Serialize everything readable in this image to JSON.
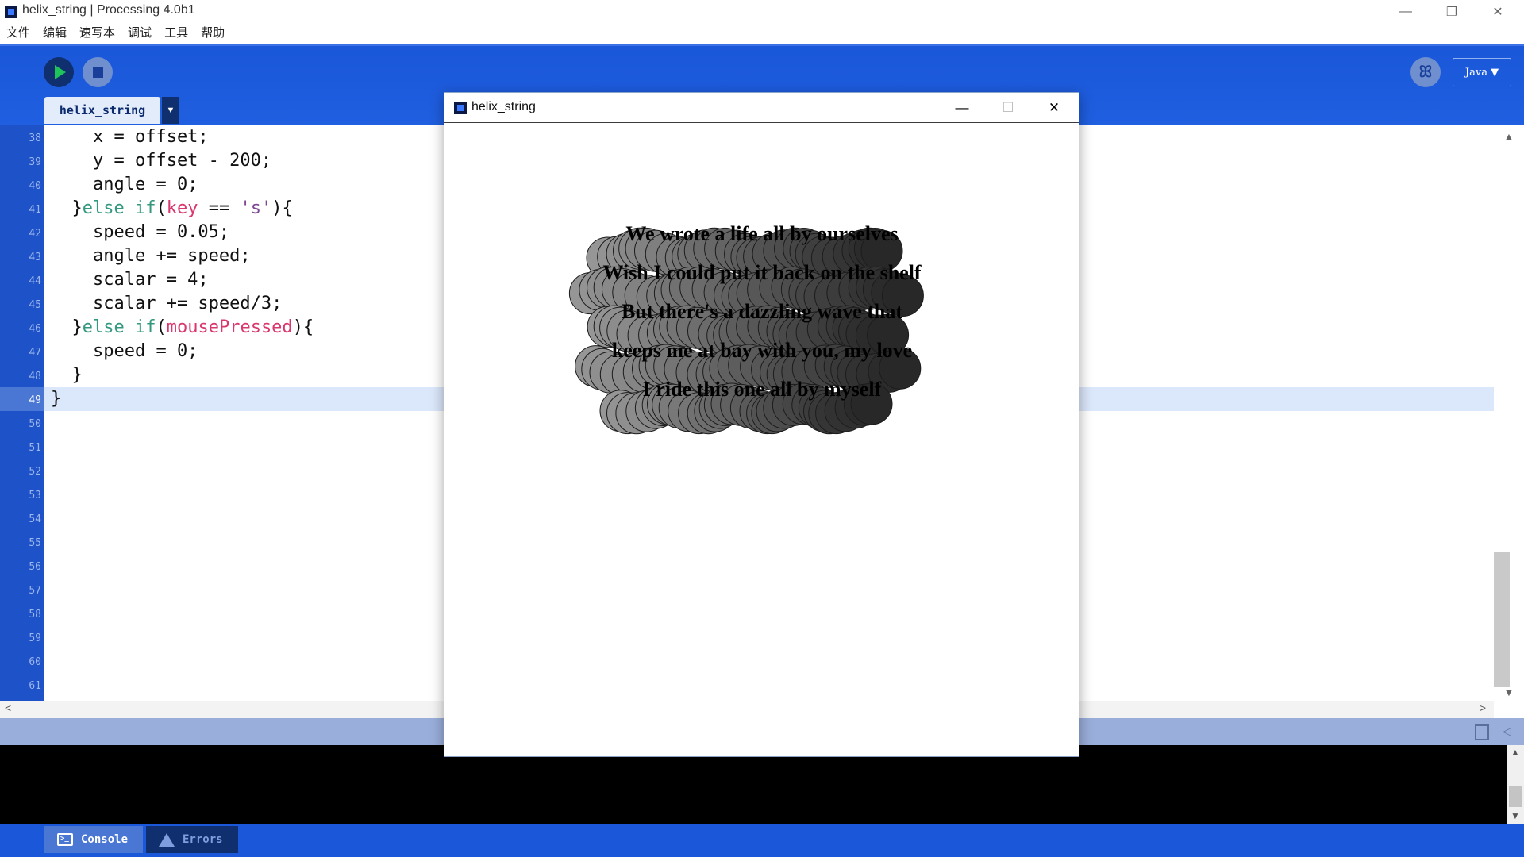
{
  "window": {
    "title": "helix_string | Processing 4.0b1",
    "controls": {
      "minimize": "—",
      "restore": "❐",
      "close": "✕"
    }
  },
  "menu": [
    "文件",
    "编辑",
    "速写本",
    "调试",
    "工具",
    "帮助"
  ],
  "toolbar": {
    "run_icon": "play-icon",
    "stop_icon": "stop-icon",
    "debug_icon": "butterfly-icon",
    "debug_glyph": "ꕤ",
    "mode_label": "Java ▼"
  },
  "tab": {
    "label": "helix_string",
    "menu_arrow": "▼"
  },
  "editor": {
    "lines": [
      {
        "num": "38",
        "text": "    x = offset;",
        "current": false
      },
      {
        "num": "39",
        "text": "    y = offset - 200;",
        "current": false
      },
      {
        "num": "40",
        "text": "    angle = 0;",
        "current": false
      },
      {
        "num": "41",
        "text": "  }else if(key == 's'){",
        "current": false
      },
      {
        "num": "42",
        "text": "    speed = 0.05;",
        "current": false
      },
      {
        "num": "43",
        "text": "    angle += speed;",
        "current": false
      },
      {
        "num": "44",
        "text": "    scalar = 4;",
        "current": false
      },
      {
        "num": "45",
        "text": "    scalar += speed/3;",
        "current": false
      },
      {
        "num": "46",
        "text": "  }else if(mousePressed){",
        "current": false
      },
      {
        "num": "47",
        "text": "    speed = 0;",
        "current": false
      },
      {
        "num": "48",
        "text": "  }",
        "current": false
      },
      {
        "num": "49",
        "text": "}",
        "current": true
      },
      {
        "num": "50",
        "text": "",
        "current": false
      },
      {
        "num": "51",
        "text": "",
        "current": false
      },
      {
        "num": "52",
        "text": "",
        "current": false
      },
      {
        "num": "53",
        "text": "",
        "current": false
      },
      {
        "num": "54",
        "text": "",
        "current": false
      },
      {
        "num": "55",
        "text": "",
        "current": false
      },
      {
        "num": "56",
        "text": "",
        "current": false
      },
      {
        "num": "57",
        "text": "",
        "current": false
      },
      {
        "num": "58",
        "text": "",
        "current": false
      },
      {
        "num": "59",
        "text": "",
        "current": false
      },
      {
        "num": "60",
        "text": "",
        "current": false
      },
      {
        "num": "61",
        "text": "",
        "current": false
      }
    ],
    "colors": {
      "keyword": "#33997e",
      "function": "#d9376e",
      "string": "#7d4793"
    }
  },
  "scroll": {
    "up": "▲",
    "down": "▼",
    "left": "<",
    "right": ">"
  },
  "status": {
    "copy_icon": "copy-icon",
    "collapse_icon": "◁"
  },
  "bottom_tabs": [
    {
      "label": "Console",
      "icon": "console-icon",
      "active": true
    },
    {
      "label": "Errors",
      "icon": "warning-icon",
      "active": false
    }
  ],
  "sketch": {
    "title": "helix_string",
    "controls": {
      "minimize": "—",
      "maximize": "☐",
      "close": "✕"
    },
    "lyrics": [
      "We wrote a life all by ourselves",
      "Wish I could put it back on the shelf",
      "But there's a dazzling wave that",
      "keeps me at bay with you, my love",
      "I ride this one all by myself"
    ]
  }
}
